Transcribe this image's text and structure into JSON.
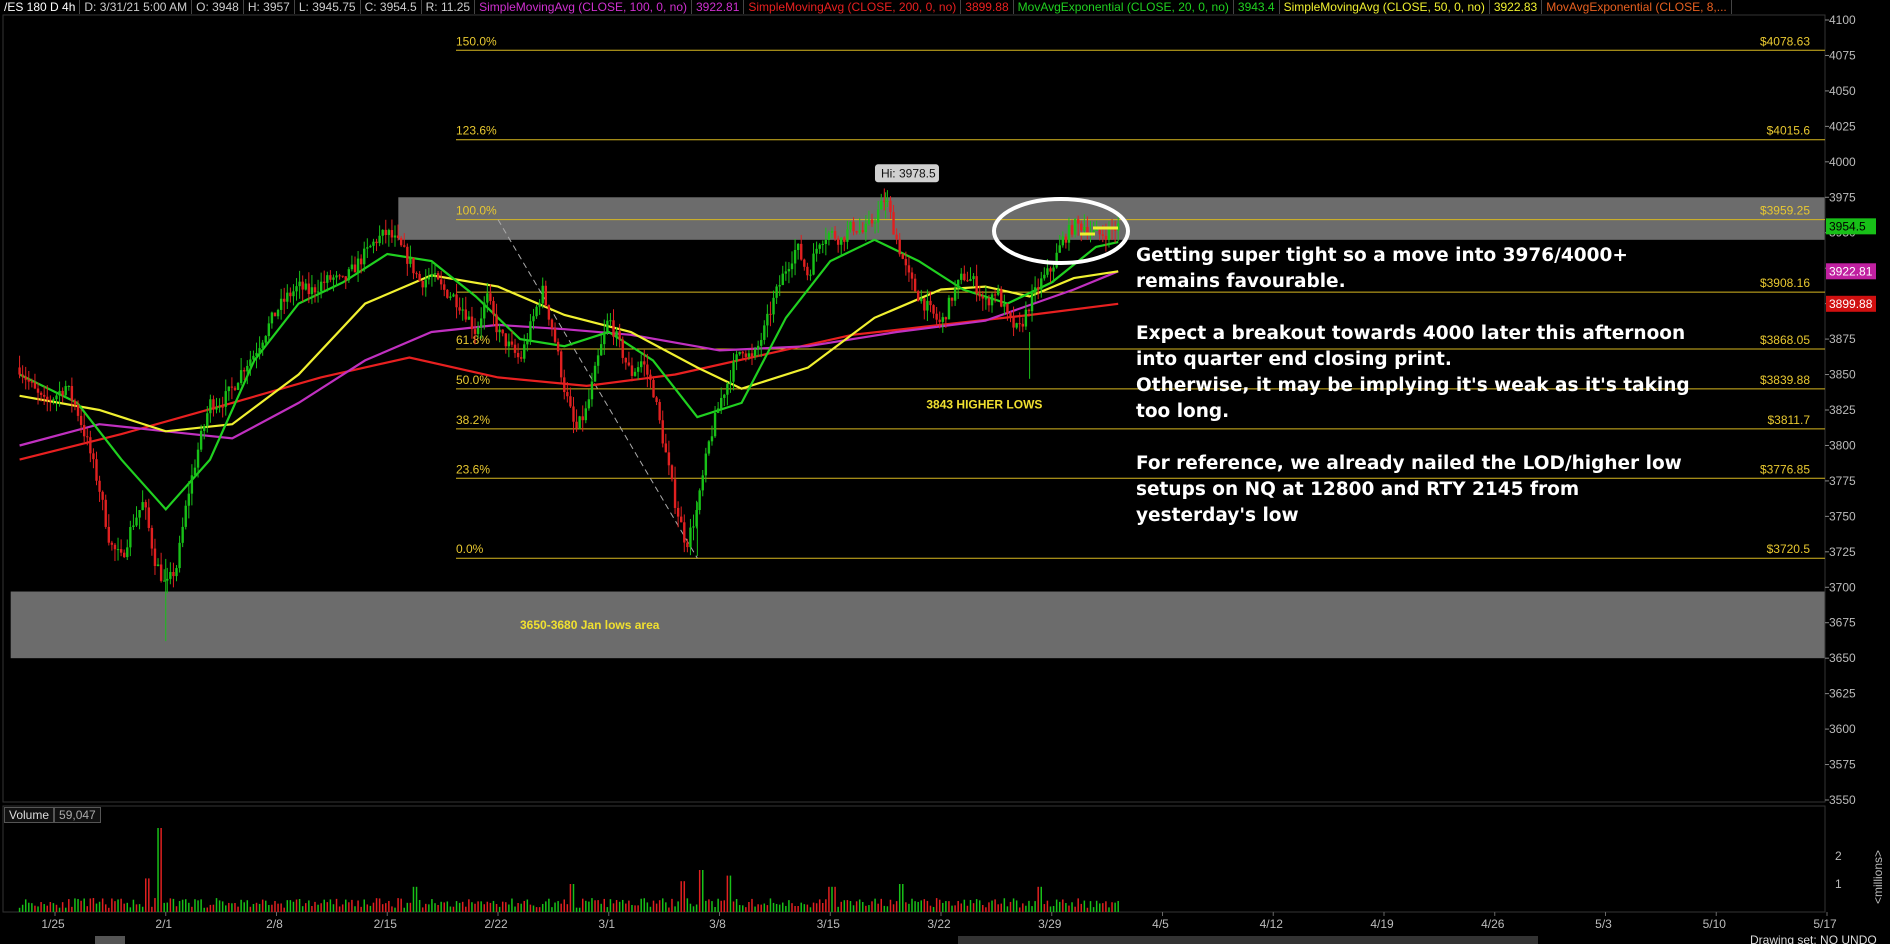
{
  "header": {
    "segments": [
      {
        "text": "/ES 180 D 4h",
        "color": "#ffffff"
      },
      {
        "text": "D: 3/31/21 5:00 AM",
        "color": "#cccccc"
      },
      {
        "text": "O: 3948",
        "color": "#cccccc"
      },
      {
        "text": "H: 3957",
        "color": "#cccccc"
      },
      {
        "text": "L: 3945.75",
        "color": "#cccccc"
      },
      {
        "text": "C: 3954.5",
        "color": "#cccccc"
      },
      {
        "text": "R: 11.25",
        "color": "#cccccc"
      },
      {
        "text": "SimpleMovingAvg (CLOSE, 100, 0, no)",
        "color": "#d030d0"
      },
      {
        "text": "3922.81",
        "color": "#d030d0"
      },
      {
        "text": "SimpleMovingAvg (CLOSE, 200, 0, no)",
        "color": "#e82020"
      },
      {
        "text": "3899.88",
        "color": "#e82020"
      },
      {
        "text": "MovAvgExponential (CLOSE, 20, 0, no)",
        "color": "#20d020"
      },
      {
        "text": "3943.4",
        "color": "#20d020"
      },
      {
        "text": "SimpleMovingAvg (CLOSE, 50, 0, no)",
        "color": "#f0f030"
      },
      {
        "text": "3922.83",
        "color": "#f0f030"
      },
      {
        "text": "MovAvgExponential (CLOSE, 8,...",
        "color": "#e86020"
      }
    ]
  },
  "chart_data": {
    "type": "candlestick",
    "symbol": "/ES",
    "timeframe": "180 D 4h",
    "ylim": [
      3550,
      4100
    ],
    "y_ticks": [
      3550,
      3575,
      3600,
      3625,
      3650,
      3675,
      3700,
      3725,
      3750,
      3775,
      3800,
      3825,
      3850,
      3875,
      3900,
      3925,
      3950,
      3975,
      4000,
      4025,
      4050,
      4075,
      4100
    ],
    "x_ticks": [
      {
        "label": "1/25",
        "idx": 0
      },
      {
        "label": "2/1",
        "idx": 5
      },
      {
        "label": "2/8",
        "idx": 10
      },
      {
        "label": "2/15",
        "idx": 15
      },
      {
        "label": "2/22",
        "idx": 20
      },
      {
        "label": "3/1",
        "idx": 25
      },
      {
        "label": "3/8",
        "idx": 30
      },
      {
        "label": "3/15",
        "idx": 35
      },
      {
        "label": "3/22",
        "idx": 40
      },
      {
        "label": "3/29",
        "idx": 45
      },
      {
        "label": "4/5",
        "idx": 50
      },
      {
        "label": "4/12",
        "idx": 55
      },
      {
        "label": "4/19",
        "idx": 60
      },
      {
        "label": "4/26",
        "idx": 65
      },
      {
        "label": "5/3",
        "idx": 70
      },
      {
        "label": "5/10",
        "idx": 75
      },
      {
        "label": "5/17",
        "idx": 80
      }
    ],
    "price_path": [
      [
        -1.6,
        3855
      ],
      [
        -1.0,
        3840
      ],
      [
        -0.5,
        3830
      ],
      [
        0,
        3835
      ],
      [
        0.5,
        3842
      ],
      [
        1,
        3825
      ],
      [
        1.5,
        3800
      ],
      [
        2,
        3770
      ],
      [
        2.5,
        3730
      ],
      [
        3,
        3720
      ],
      [
        3.5,
        3745
      ],
      [
        4,
        3760
      ],
      [
        4.5,
        3720
      ],
      [
        5,
        3700
      ],
      [
        5.5,
        3715
      ],
      [
        6,
        3765
      ],
      [
        6.5,
        3800
      ],
      [
        7,
        3830
      ],
      [
        7.5,
        3830
      ],
      [
        8,
        3840
      ],
      [
        8.5,
        3855
      ],
      [
        9,
        3865
      ],
      [
        9.5,
        3880
      ],
      [
        10,
        3895
      ],
      [
        10.5,
        3905
      ],
      [
        11,
        3912
      ],
      [
        11.5,
        3908
      ],
      [
        12,
        3914
      ],
      [
        12.5,
        3918
      ],
      [
        13,
        3915
      ],
      [
        13.5,
        3925
      ],
      [
        14,
        3935
      ],
      [
        14.5,
        3945
      ],
      [
        15,
        3950
      ],
      [
        15.5,
        3942
      ],
      [
        16,
        3930
      ],
      [
        16.5,
        3915
      ],
      [
        17,
        3920
      ],
      [
        17.5,
        3910
      ],
      [
        18,
        3905
      ],
      [
        18.5,
        3895
      ],
      [
        19,
        3880
      ],
      [
        19.5,
        3905
      ],
      [
        20,
        3880
      ],
      [
        20.5,
        3870
      ],
      [
        21,
        3860
      ],
      [
        21.5,
        3885
      ],
      [
        22,
        3910
      ],
      [
        22.5,
        3880
      ],
      [
        23,
        3840
      ],
      [
        23.5,
        3810
      ],
      [
        24,
        3825
      ],
      [
        24.5,
        3860
      ],
      [
        25,
        3890
      ],
      [
        25.5,
        3870
      ],
      [
        26,
        3850
      ],
      [
        26.5,
        3860
      ],
      [
        27,
        3840
      ],
      [
        27.5,
        3800
      ],
      [
        28,
        3760
      ],
      [
        28.5,
        3730
      ],
      [
        29,
        3755
      ],
      [
        29.5,
        3800
      ],
      [
        30,
        3830
      ],
      [
        30.5,
        3850
      ],
      [
        31,
        3870
      ],
      [
        31.5,
        3860
      ],
      [
        32,
        3880
      ],
      [
        32.5,
        3905
      ],
      [
        33,
        3925
      ],
      [
        33.5,
        3940
      ],
      [
        34,
        3920
      ],
      [
        34.5,
        3945
      ],
      [
        35,
        3950
      ],
      [
        35.5,
        3945
      ],
      [
        36,
        3955
      ],
      [
        36.5,
        3950
      ],
      [
        37,
        3960
      ],
      [
        37.5,
        3975
      ],
      [
        38,
        3945
      ],
      [
        38.5,
        3920
      ],
      [
        39,
        3905
      ],
      [
        39.5,
        3895
      ],
      [
        40,
        3885
      ],
      [
        40.5,
        3905
      ],
      [
        41,
        3920
      ],
      [
        41.5,
        3915
      ],
      [
        42,
        3900
      ],
      [
        42.5,
        3910
      ],
      [
        43,
        3890
      ],
      [
        43.5,
        3880
      ],
      [
        44,
        3900
      ],
      [
        44.5,
        3915
      ],
      [
        45,
        3925
      ],
      [
        45.5,
        3945
      ],
      [
        46,
        3955
      ],
      [
        46.5,
        3955
      ],
      [
        47,
        3948
      ],
      [
        47.5,
        3950
      ],
      [
        48,
        3954.5
      ]
    ],
    "volume": {
      "label": "Volume",
      "value": "59,047",
      "unit_label": "<millions>",
      "y_ticks": [
        "2",
        "1"
      ],
      "spikes": [
        [
          4.7,
          3.0
        ],
        [
          4.2,
          1.2
        ],
        [
          16.3,
          0.9
        ],
        [
          23.3,
          1.0
        ],
        [
          28.3,
          1.1
        ],
        [
          29.2,
          1.5
        ],
        [
          30.4,
          1.3
        ],
        [
          35.1,
          0.9
        ],
        [
          38.2,
          1.0
        ],
        [
          44.5,
          0.9
        ]
      ]
    },
    "moving_averages": [
      {
        "name": "SMA 200",
        "color": "#e82020",
        "points": [
          [
            -1.6,
            3790
          ],
          [
            3,
            3808
          ],
          [
            8,
            3830
          ],
          [
            12,
            3848
          ],
          [
            16,
            3862
          ],
          [
            20,
            3848
          ],
          [
            24,
            3842
          ],
          [
            28,
            3850
          ],
          [
            32,
            3864
          ],
          [
            36,
            3878
          ],
          [
            40,
            3885
          ],
          [
            44,
            3892
          ],
          [
            48,
            3899.88
          ]
        ]
      },
      {
        "name": "SMA 100",
        "color": "#c030c0",
        "points": [
          [
            -1.6,
            3800
          ],
          [
            2,
            3815
          ],
          [
            5,
            3810
          ],
          [
            8,
            3805
          ],
          [
            11,
            3830
          ],
          [
            14,
            3860
          ],
          [
            17,
            3880
          ],
          [
            20,
            3885
          ],
          [
            23,
            3882
          ],
          [
            26,
            3878
          ],
          [
            30,
            3867
          ],
          [
            34,
            3870
          ],
          [
            38,
            3880
          ],
          [
            42,
            3888
          ],
          [
            46,
            3910
          ],
          [
            48,
            3922.81
          ]
        ]
      },
      {
        "name": "SMA 50",
        "color": "#f0f030",
        "points": [
          [
            -1.6,
            3835
          ],
          [
            2,
            3825
          ],
          [
            5,
            3810
          ],
          [
            8,
            3815
          ],
          [
            11,
            3850
          ],
          [
            14,
            3900
          ],
          [
            17,
            3920
          ],
          [
            20,
            3912
          ],
          [
            23,
            3892
          ],
          [
            26,
            3880
          ],
          [
            29,
            3855
          ],
          [
            31,
            3840
          ],
          [
            34,
            3855
          ],
          [
            37,
            3890
          ],
          [
            40,
            3910
          ],
          [
            42,
            3912
          ],
          [
            44,
            3905
          ],
          [
            46,
            3918
          ],
          [
            48,
            3922.83
          ]
        ]
      },
      {
        "name": "EMA 20",
        "color": "#20d020",
        "points": [
          [
            -1.6,
            3850
          ],
          [
            1,
            3830
          ],
          [
            3,
            3790
          ],
          [
            5,
            3755
          ],
          [
            7,
            3790
          ],
          [
            9,
            3860
          ],
          [
            11,
            3900
          ],
          [
            13,
            3915
          ],
          [
            15,
            3935
          ],
          [
            17,
            3930
          ],
          [
            19,
            3905
          ],
          [
            21,
            3875
          ],
          [
            23,
            3870
          ],
          [
            25,
            3880
          ],
          [
            27,
            3860
          ],
          [
            29,
            3820
          ],
          [
            31,
            3830
          ],
          [
            33,
            3890
          ],
          [
            35,
            3930
          ],
          [
            37,
            3945
          ],
          [
            39,
            3930
          ],
          [
            41,
            3910
          ],
          [
            43,
            3900
          ],
          [
            45,
            3915
          ],
          [
            47,
            3940
          ],
          [
            48,
            3943.4
          ]
        ]
      }
    ],
    "fib_levels": [
      {
        "label": "150.0%",
        "price": 4078.63,
        "text": "$4078.63"
      },
      {
        "label": "123.6%",
        "price": 4015.6,
        "text": "$4015.6"
      },
      {
        "label": "100.0%",
        "price": 3959.25,
        "text": "$3959.25"
      },
      {
        "label": "",
        "price": 3908.16,
        "text": "$3908.16"
      },
      {
        "label": "61.8%",
        "price": 3868.05,
        "text": "$3868.05"
      },
      {
        "label": "50.0%",
        "price": 3839.88,
        "text": "$3839.88"
      },
      {
        "label": "38.2%",
        "price": 3811.7,
        "text": "$3811.7"
      },
      {
        "label": "23.6%",
        "price": 3776.85,
        "text": "$3776.85"
      },
      {
        "label": "0.0%",
        "price": 3720.5,
        "text": "$3720.5"
      }
    ],
    "fib_start_idx": 20,
    "fib_diagonal": [
      [
        20,
        3959.25
      ],
      [
        29,
        3720.5
      ]
    ],
    "zones": [
      {
        "from": 3945,
        "to": 3975,
        "start_idx": 15.5,
        "label": ""
      },
      {
        "from": 3650,
        "to": 3697,
        "start_idx": -2,
        "label": "3650-3680 Jan lows area"
      }
    ],
    "annotations": [
      {
        "text": "Hi: 3978.5",
        "idx": 37.2,
        "price": 3978.5
      },
      {
        "text": "3843 HIGHER LOWS",
        "idx": 42.5,
        "price": 3826
      }
    ],
    "price_tags": [
      {
        "text": "3954.5",
        "price": 3954.5,
        "bg": "#18c018",
        "fg": "#000000"
      },
      {
        "text": "3922.81",
        "price": 3922.81,
        "bg": "#c020a0",
        "fg": "#ffffff"
      },
      {
        "text": "3899.88",
        "price": 3899.88,
        "bg": "#d01010",
        "fg": "#ffffff"
      }
    ]
  },
  "commentary": {
    "p1": "Getting super tight so a move into 3976/4000+ remains favourable.",
    "p2a": "Expect a breakout towards 4000 later this afternoon into quarter end closing print.",
    "p2b": "Otherwise, it may be implying it's weak as it's taking too long.",
    "p3": "For reference, we already nailed the LOD/higher low setups on NQ at 12800 and RTY 2145 from yesterday's low"
  },
  "footer": {
    "drawing_status": "Drawing set: NO UNDO"
  }
}
